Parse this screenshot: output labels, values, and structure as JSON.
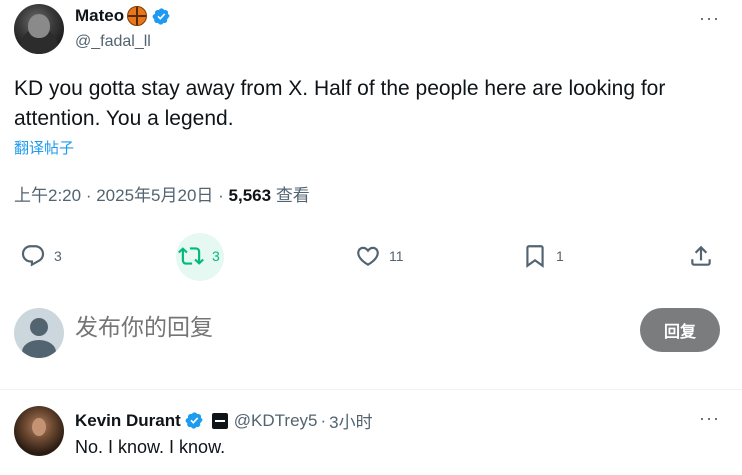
{
  "post": {
    "author_name": "Mateo",
    "author_handle": "@_fadal_ll",
    "more_label": "···",
    "text": "KD you gotta stay away from X. Half of the people here are looking for attention. You a legend.",
    "translate_label": "翻译帖子",
    "time": "上午2:20",
    "date": "2025年5月20日",
    "views_count": "5,563",
    "views_label": "查看"
  },
  "actions": {
    "reply_count": "3",
    "retweet_count": "3",
    "like_count": "11",
    "bookmark_count": "1"
  },
  "compose": {
    "placeholder": "发布你的回复",
    "button_label": "回复"
  },
  "reply": {
    "author_name": "Kevin Durant",
    "author_handle": "@KDTrey5",
    "dot": "·",
    "time": "3小时",
    "more_label": "···",
    "text": "No. I know. I know."
  },
  "colors": {
    "verified_blue": "#1d9bf0",
    "retweet_green": "#00ba7c",
    "muted_text": "#536471"
  },
  "icons": {
    "reply": "reply-icon",
    "retweet": "retweet-icon",
    "like": "heart-icon",
    "bookmark": "bookmark-icon",
    "share": "share-icon",
    "verified": "verified-badge-icon",
    "emoji": "basketball-emoji-icon"
  }
}
